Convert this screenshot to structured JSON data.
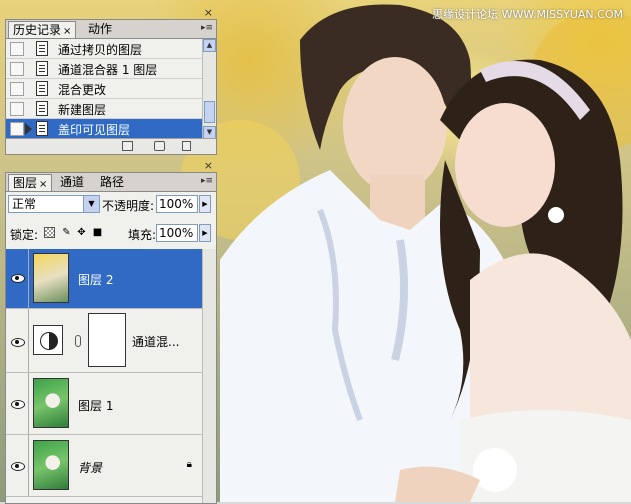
{
  "watermark": "思缘设计论坛 WWW.MISSYUAN.COM",
  "history_panel": {
    "tabs": [
      "历史记录",
      "动作"
    ],
    "close_glyph": "×",
    "items": [
      {
        "label": "通过拷贝的图层"
      },
      {
        "label": "通道混合器 1 图层"
      },
      {
        "label": "混合更改"
      },
      {
        "label": "新建图层"
      },
      {
        "label": "盖印可见图层",
        "selected": true
      }
    ]
  },
  "layers_panel": {
    "tabs": [
      "图层",
      "通道",
      "路径"
    ],
    "close_glyph": "×",
    "blend_mode": "正常",
    "opacity_label": "不透明度:",
    "opacity_value": "100%",
    "lock_label": "锁定:",
    "fill_label": "填充:",
    "fill_value": "100%",
    "layers": [
      {
        "name": "图层 2",
        "selected": true
      },
      {
        "name": "通道混..."
      },
      {
        "name": "图层 1"
      },
      {
        "name": "背景",
        "locked": true
      }
    ]
  },
  "colors": {
    "selection": "#316ac5",
    "panel_bg": "#f0f0ed"
  }
}
